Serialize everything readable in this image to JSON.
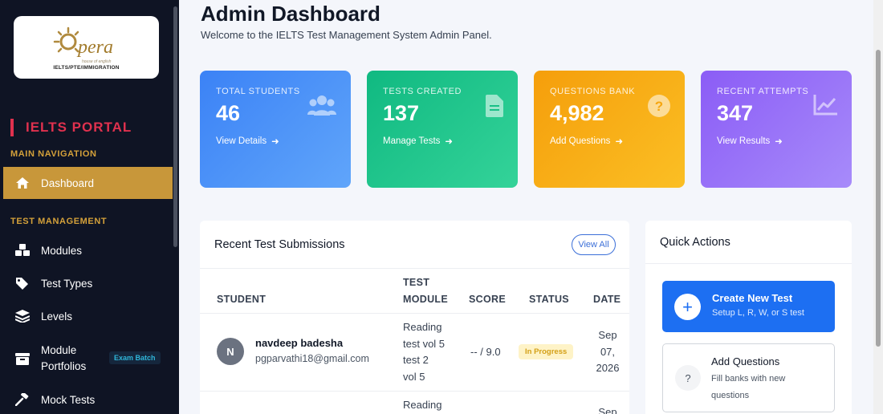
{
  "colors": {
    "sidebar_bg": "#0f1424",
    "accent_gold": "#c8973a",
    "portal_red": "#e0314e",
    "primary_blue": "#1d6ff2"
  },
  "sidebar": {
    "logo": {
      "word": "pera",
      "tagline": "house of english",
      "subtitle": "IELTS/PTE/IMMIGRATION"
    },
    "portal_title": "IELTS PORTAL",
    "main_nav_label": "MAIN NAVIGATION",
    "test_mgmt_label": "TEST MANAGEMENT",
    "items": [
      {
        "label": "Dashboard",
        "icon": "home-icon",
        "active": true
      },
      {
        "label": "Modules",
        "icon": "cubes-icon"
      },
      {
        "label": "Test Types",
        "icon": "tags-icon"
      },
      {
        "label": "Levels",
        "icon": "layers-icon"
      },
      {
        "label": "Module",
        "label2": "Portfolios",
        "icon": "archive-icon",
        "badge": "Exam Batch"
      },
      {
        "label": "Mock Tests",
        "icon": "gavel-icon"
      }
    ]
  },
  "header": {
    "title": "Admin Dashboard",
    "subtitle": "Welcome to the IELTS Test Management System Admin Panel."
  },
  "stats": [
    {
      "label": "TOTAL STUDENTS",
      "value": "46",
      "link": "View Details",
      "icon": "users-icon"
    },
    {
      "label": "TESTS CREATED",
      "value": "137",
      "link": "Manage Tests",
      "icon": "file-icon"
    },
    {
      "label": "QUESTIONS BANK",
      "value": "4,982",
      "link": "Add Questions",
      "icon": "question-circle-icon"
    },
    {
      "label": "RECENT ATTEMPTS",
      "value": "347",
      "link": "View Results",
      "icon": "chart-line-icon"
    }
  ],
  "submissions": {
    "title": "Recent Test Submissions",
    "view_all": "View All",
    "columns": [
      "STUDENT",
      "TEST",
      "MODULE",
      "SCORE",
      "STATUS",
      "DATE"
    ],
    "rows": [
      {
        "initial": "N",
        "name": "navdeep badesha",
        "email": "pgparvathi18@gmail.com",
        "module_lines": [
          "Reading",
          "test vol 5",
          "test 2",
          "vol 5"
        ],
        "score": "-- / 9.0",
        "status": "In Progress",
        "date_lines": [
          "Sep",
          "07,",
          "2026"
        ]
      },
      {
        "module_lines": [
          "Reading"
        ],
        "date_lines": [
          "Sep"
        ]
      }
    ]
  },
  "quick_actions": {
    "title": "Quick Actions",
    "primary": {
      "title": "Create New Test",
      "subtitle": "Setup L, R, W, or S test",
      "icon": "plus-icon"
    },
    "secondary": {
      "title": "Add Questions",
      "subtitle": "Fill banks with new questions",
      "icon": "question-icon"
    }
  }
}
